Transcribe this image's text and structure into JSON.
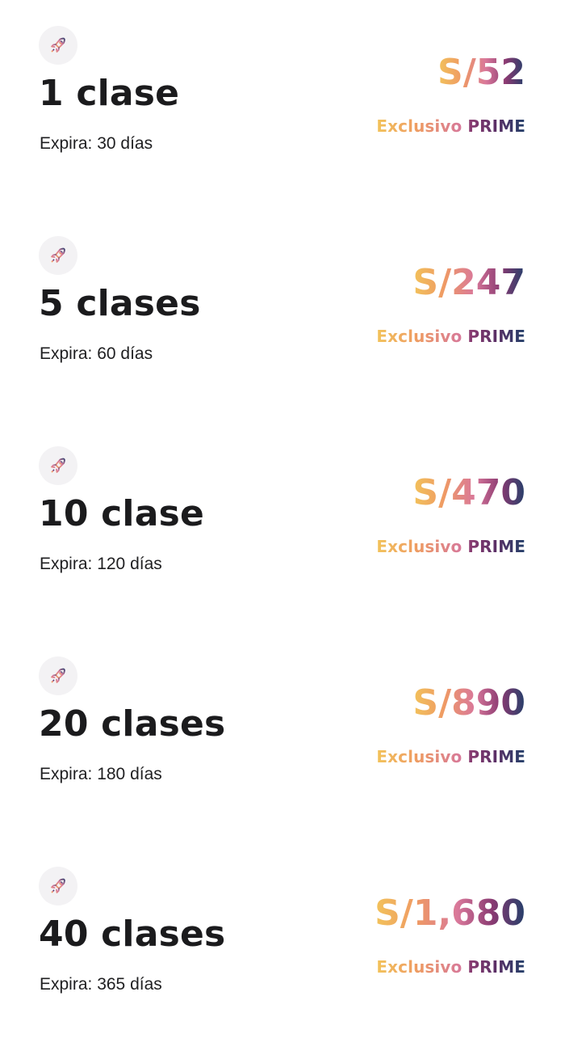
{
  "colors": {
    "title_text": "#1b1b1d",
    "icon_background": "#f3f2f4",
    "gradient_start": "#f2c35a",
    "gradient_mid": "#d9789a",
    "gradient_end": "#243f6a"
  },
  "plans": [
    {
      "icon": "rocket-icon",
      "title": "1 clase",
      "expiry": "Expira: 30 días",
      "price": "S/52",
      "badge_exclusive": "Exclusivo",
      "badge_prime": "PRIME"
    },
    {
      "icon": "rocket-icon",
      "title": "5 clases",
      "expiry": "Expira: 60 días",
      "price": "S/247",
      "badge_exclusive": "Exclusivo",
      "badge_prime": "PRIME"
    },
    {
      "icon": "rocket-icon",
      "title": "10 clase",
      "expiry": "Expira: 120 días",
      "price": "S/470",
      "badge_exclusive": "Exclusivo",
      "badge_prime": "PRIME"
    },
    {
      "icon": "rocket-icon",
      "title": "20 clases",
      "expiry": "Expira: 180 días",
      "price": "S/890",
      "badge_exclusive": "Exclusivo",
      "badge_prime": "PRIME"
    },
    {
      "icon": "rocket-icon",
      "title": "40 clases",
      "expiry": "Expira: 365 días",
      "price": "S/1,680",
      "badge_exclusive": "Exclusivo",
      "badge_prime": "PRIME"
    }
  ]
}
